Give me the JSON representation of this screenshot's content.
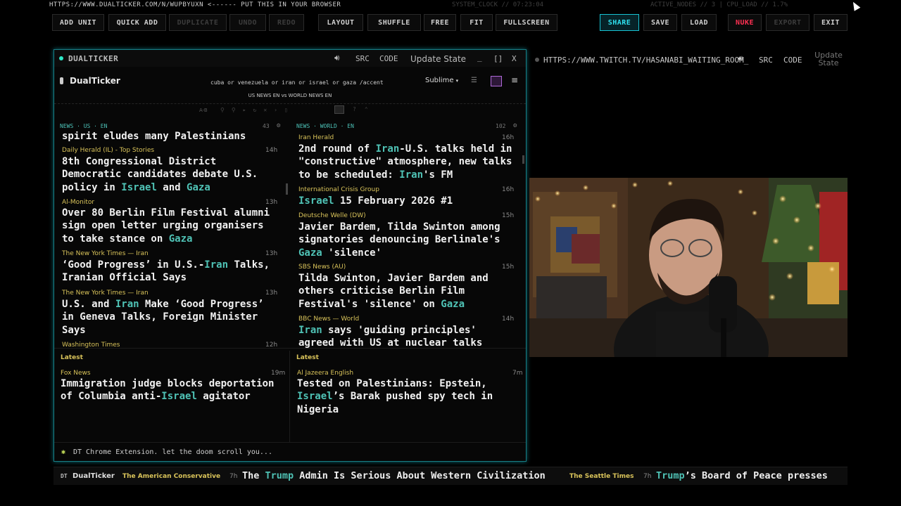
{
  "topbar": {
    "url": "HTTPS://WWW.DUALTICKER.COM/N/WUPBYUXN <------ PUT THIS IN YOUR BROWSER",
    "system_clock": "SYSTEM_CLOCK // 07:23:04",
    "status": "ACTIVE_NODES // 3 | CPU_LOAD // 1.7%"
  },
  "toolbar": {
    "add_unit": "ADD UNIT",
    "quick_add": "QUICK ADD",
    "duplicate": "DUPLICATE",
    "undo": "UNDO",
    "redo": "REDO",
    "layout": "LAYOUT",
    "shuffle": "SHUFFLE",
    "free": "FREE",
    "fit": "FIT",
    "fullscreen": "FULLSCREEN",
    "share": "SHARE",
    "save": "SAVE",
    "load": "LOAD",
    "nuke": "NUKE",
    "export": "EXPORT",
    "exit": "EXIT"
  },
  "left_window": {
    "title": "DUALTICKER",
    "src": "SRC",
    "code": "CODE",
    "update_state": "Update State",
    "minimize": "_",
    "maximize": "[]",
    "close": "X"
  },
  "app": {
    "name": "DualTicker",
    "search": "cuba or venezuela or iran or israel or gaza /accent",
    "theme": "Sublime",
    "comparison": "US NEWS EN vs WORLD NEWS EN",
    "ab": "A-B"
  },
  "us_column": {
    "label": "NEWS · US · EN",
    "count": "43",
    "top_cut": "spirit eludes many Palestinians",
    "items": [
      {
        "source": "Daily Herald (IL) - Top Stories",
        "time": "14h"
      },
      {
        "source": "Al-Monitor",
        "time": "13h"
      },
      {
        "source": "The New York Times — Iran",
        "time": "13h"
      },
      {
        "source": "The New York Times — Iran",
        "time": "13h"
      },
      {
        "source": "Washington Times",
        "time": "12h"
      }
    ]
  },
  "world_column": {
    "label": "NEWS · WORLD · EN",
    "count": "102",
    "items": [
      {
        "source": "Iran Herald",
        "time": "16h"
      },
      {
        "source": "International Crisis Group",
        "time": "16h"
      },
      {
        "source": "Deutsche Welle (DW)",
        "time": "15h"
      },
      {
        "source": "SBS News (AU)",
        "time": "15h"
      },
      {
        "source": "BBC News — World",
        "time": "14h"
      }
    ]
  },
  "latest": {
    "label_left": "Latest",
    "label_right": "Latest",
    "left": {
      "source": "Fox News",
      "time": "19m"
    },
    "right": {
      "source": "Al Jazeera English",
      "time": "7m"
    }
  },
  "footer_text": "DT Chrome Extension. let the doom scroll you...",
  "right_window": {
    "url": "HTTPS://WWW.TWITCH.TV/HASANABI_WAITING_ROOM_",
    "src": "SRC",
    "code": "CODE",
    "update_state": "Update State"
  },
  "ticker": {
    "brand": "DualTicker",
    "items": [
      {
        "source": "The American Conservative",
        "time": "7h"
      },
      {
        "source": "The Seattle Times",
        "time": "7h"
      }
    ]
  }
}
